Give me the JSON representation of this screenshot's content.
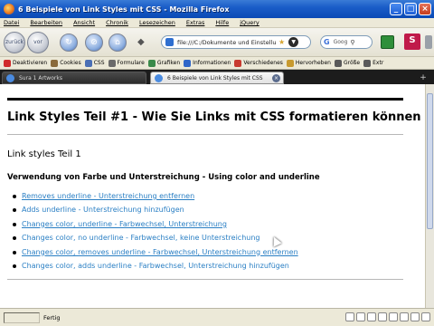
{
  "window": {
    "title": "6 Beispiele von Link Styles mit CSS - Mozilla Firefox",
    "buttons": {
      "minimize": "_",
      "maximize": "□",
      "close": "×"
    }
  },
  "menu": [
    "Datei",
    "Bearbeiten",
    "Ansicht",
    "Chronik",
    "Lesezeichen",
    "Extras",
    "Hilfe",
    "jQuery"
  ],
  "toolbar": {
    "back_label": "zurück",
    "forward_label": "vor",
    "url": "file:///C:/Dokumente und Einstellu",
    "search_engine": "G",
    "search_placeholder": "Goog",
    "addon_label": "S"
  },
  "bookmarks": [
    {
      "label": "Deaktivieren",
      "icon": "forbidden-icon",
      "color": "#d02b2b"
    },
    {
      "label": "Cookies",
      "icon": "cookie-icon",
      "color": "#8a6a3a"
    },
    {
      "label": "CSS",
      "icon": "css-icon",
      "color": "#4a6fb5"
    },
    {
      "label": "Formulare",
      "icon": "form-icon",
      "color": "#6a6a6a"
    },
    {
      "label": "Grafiken",
      "icon": "image-icon",
      "color": "#3a8a4a"
    },
    {
      "label": "Informationen",
      "icon": "info-icon",
      "color": "#2f66c8"
    },
    {
      "label": "Verschiedenes",
      "icon": "misc-icon",
      "color": "#c83a2f"
    },
    {
      "label": "Hervorheben",
      "icon": "pencil-icon",
      "color": "#c89a2f"
    },
    {
      "label": "Größe",
      "icon": "resize-icon",
      "color": "#5a5a5a"
    },
    {
      "label": "Extr",
      "icon": "tools-icon",
      "color": "#5a5a5a"
    }
  ],
  "tabs": [
    {
      "label": "Sura 1 Artworks",
      "active": false
    },
    {
      "label": "6 Beispiele von Link Styles mit CSS",
      "active": true
    }
  ],
  "page": {
    "heading": "Link Styles Teil #1 - Wie Sie Links mit CSS formatieren können",
    "subheading": "Link styles Teil 1",
    "section_title": "Verwendung von Farbe und Unterstreichung - Using color and underline",
    "links": [
      {
        "text": "Removes underline - Unterstreichung entfernen",
        "underlined": true
      },
      {
        "text": "Adds underline - Unterstreichung hinzufügen",
        "underlined": false
      },
      {
        "text": "Changes color, underline - Farbwechsel, Unterstreichung",
        "underlined": true
      },
      {
        "text": "Changes color, no underline - Farbwechsel, keine Unterstreichung",
        "underlined": false
      },
      {
        "text": "Changes color, removes underline - Farbwechsel, Unterstreichung entfernen",
        "underlined": true
      },
      {
        "text": "Changes color, adds underline - Farbwechsel, Unterstreichung hinzufügen",
        "underlined": false
      }
    ],
    "link_color": "#2a7fc4"
  },
  "status": {
    "text": "Fertig"
  }
}
